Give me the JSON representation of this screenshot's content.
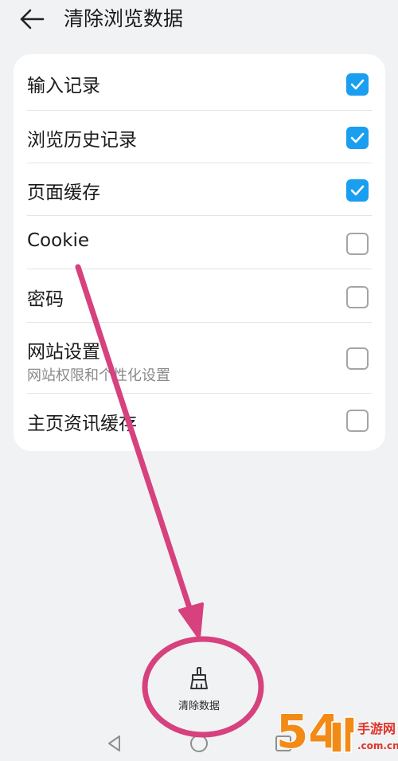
{
  "header": {
    "title": "清除浏览数据",
    "back_icon": "arrow-left-icon"
  },
  "options": [
    {
      "id": "input-records",
      "label": "输入记录",
      "checked": true
    },
    {
      "id": "browsing-history",
      "label": "浏览历史记录",
      "checked": true
    },
    {
      "id": "page-cache",
      "label": "页面缓存",
      "checked": true
    },
    {
      "id": "cookie",
      "label": "Cookie",
      "checked": false
    },
    {
      "id": "password",
      "label": "密码",
      "checked": false
    },
    {
      "id": "site-settings",
      "label": "网站设置",
      "sublabel": "网站权限和个性化设置",
      "checked": false
    },
    {
      "id": "homepage-news-cache",
      "label": "主页资讯缓存",
      "checked": false
    }
  ],
  "clear_button": {
    "label": "清除数据",
    "icon": "broom-icon"
  },
  "navbar": {
    "back_icon": "triangle-back-icon",
    "home_icon": "circle-home-icon",
    "recents_icon": "square-recents-icon"
  },
  "colors": {
    "accent": "#1a9ef0",
    "annotation": "#d6417e",
    "background": "#f1f2f4",
    "card": "#ffffff"
  },
  "watermark": {
    "digits": "54",
    "brand_text": "手游网",
    "domain": ".com.cn"
  }
}
